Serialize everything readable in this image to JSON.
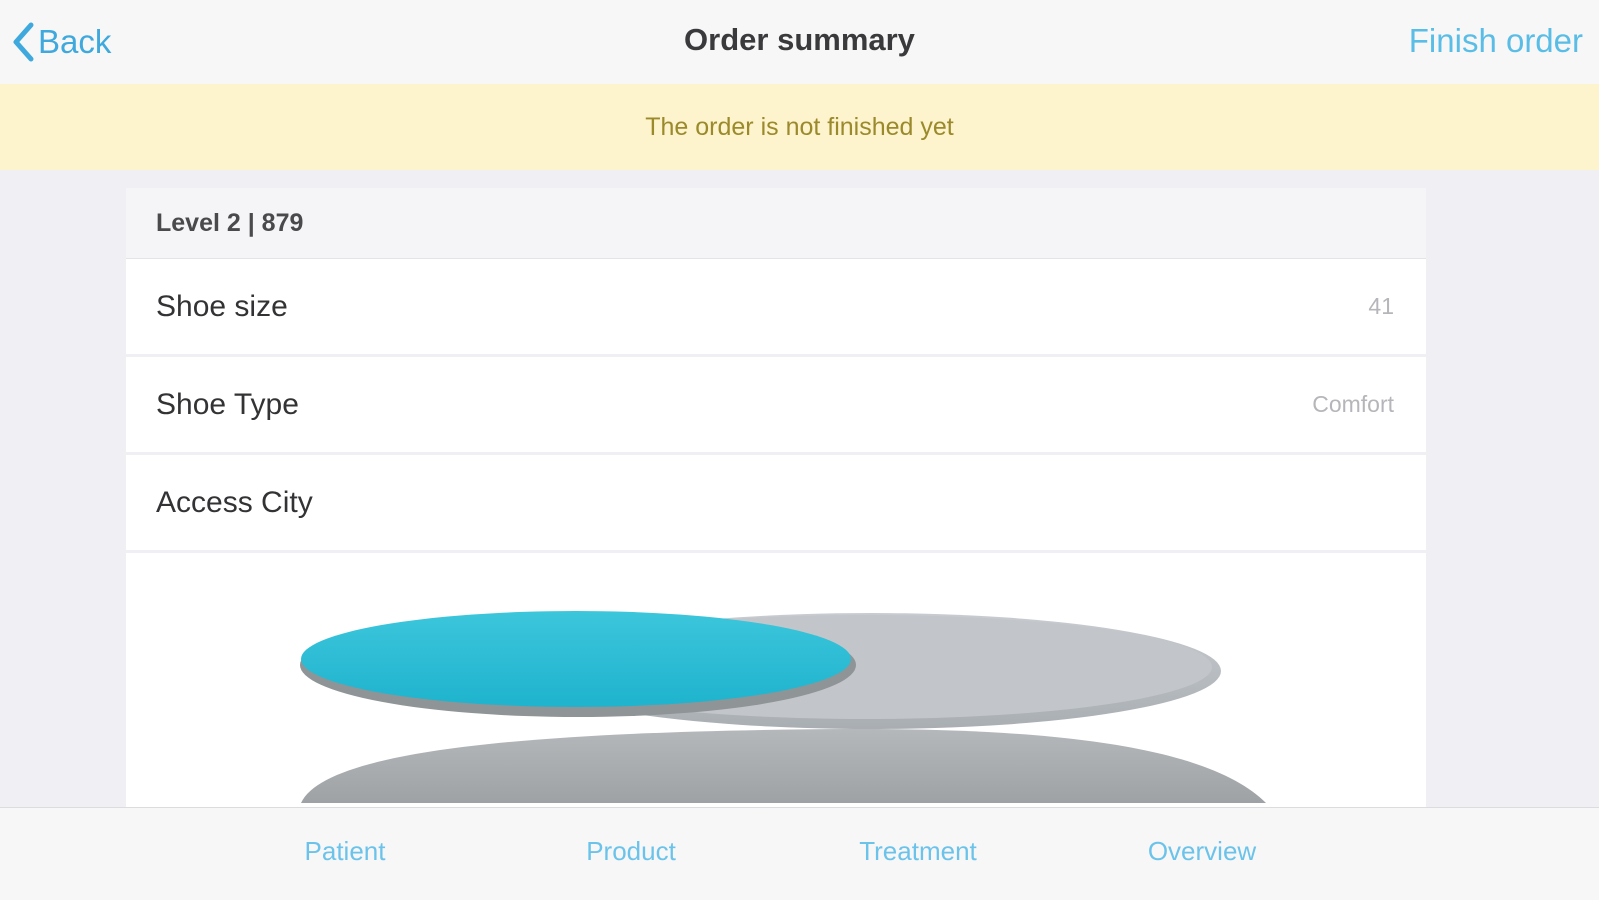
{
  "navbar": {
    "back_label": "Back",
    "title": "Order summary",
    "finish_label": "Finish order"
  },
  "banner": {
    "text": "The order is not finished yet"
  },
  "section": {
    "header": "Level 2 | 879",
    "rows": [
      {
        "label": "Shoe size",
        "value": "41"
      },
      {
        "label": "Shoe Type",
        "value": "Comfort"
      },
      {
        "label": "Access City",
        "value": ""
      }
    ]
  },
  "product_image": {
    "icon": "insole-image",
    "colors": {
      "accent": "#29bdd6",
      "base": "#b9bec2"
    }
  },
  "tabbar": {
    "tabs": [
      {
        "label": "Patient"
      },
      {
        "label": "Product"
      },
      {
        "label": "Treatment"
      },
      {
        "label": "Overview"
      }
    ]
  },
  "colors": {
    "tint": "#3fa9dd",
    "banner_bg": "#fdf3cc",
    "banner_text": "#9a8a2c",
    "background": "#efeff4"
  }
}
